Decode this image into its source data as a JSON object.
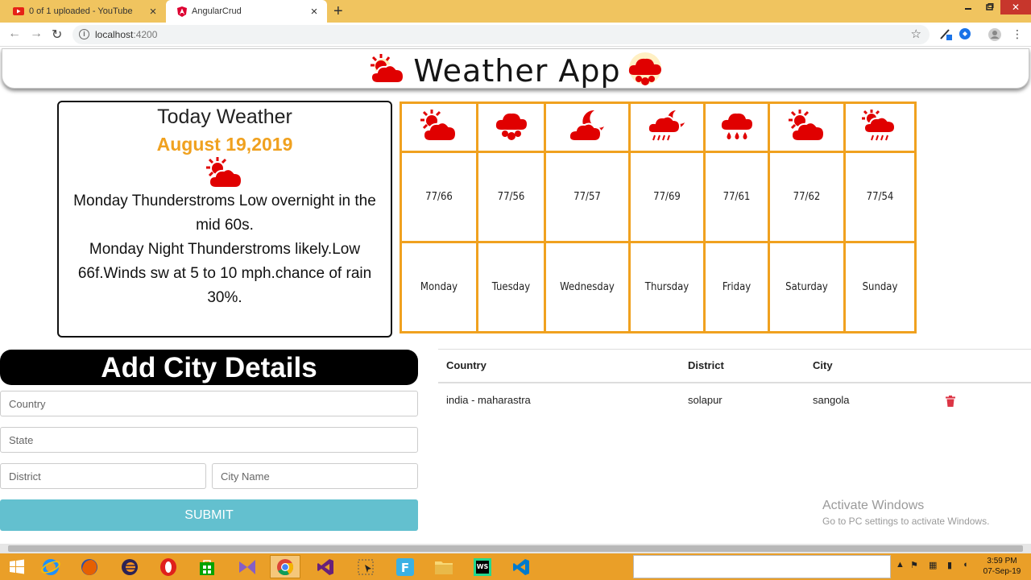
{
  "browser": {
    "tabs": [
      {
        "title": "0 of 1 uploaded - YouTube",
        "active": false,
        "icon": "youtube-icon"
      },
      {
        "title": "AngularCrud",
        "active": true,
        "icon": "angular-icon"
      }
    ],
    "url_host": "localhost",
    "url_port": ":4200"
  },
  "app": {
    "title": "Weather App",
    "title_icons": [
      "sun-cloud-icon",
      "hail-cloud-icon"
    ]
  },
  "today": {
    "heading": "Today Weather",
    "date": "August 19,2019",
    "icon": "sun-cloud-icon",
    "line1": "Monday Thunderstroms Low overnight in the mid 60s.",
    "line2": "Monday Night Thunderstroms likely.Low 66f.Winds sw at 5 to 10 mph.chance of rain 30%."
  },
  "forecast": [
    {
      "icon": "sun-cloud-icon",
      "temp": "77/66",
      "day": "Monday"
    },
    {
      "icon": "hail-cloud-icon",
      "temp": "77/56",
      "day": "Tuesday"
    },
    {
      "icon": "moon-cloud-icon",
      "temp": "77/57",
      "day": "Wednesday"
    },
    {
      "icon": "moon-rain-cloud-icon",
      "temp": "77/69",
      "day": "Thursday"
    },
    {
      "icon": "rain-cloud-icon",
      "temp": "77/61",
      "day": "Friday"
    },
    {
      "icon": "sun-cloud-icon",
      "temp": "77/62",
      "day": "Saturday"
    },
    {
      "icon": "sun-rain-cloud-icon",
      "temp": "77/54",
      "day": "Sunday"
    }
  ],
  "form": {
    "heading": "Add City Details",
    "country_placeholder": "Country",
    "state_placeholder": "State",
    "district_placeholder": "District",
    "city_placeholder": "City Name",
    "submit_label": "SUBMIT"
  },
  "table": {
    "headers": {
      "country": "Country",
      "district": "District",
      "city": "City"
    },
    "rows": [
      {
        "country": "india - maharastra",
        "district": "solapur",
        "city": "sangola"
      }
    ]
  },
  "watermark": {
    "line1": "Activate Windows",
    "line2": "Go to PC settings to activate Windows."
  },
  "taskbar": {
    "time": "3:59 PM",
    "date": "07-Sep-19"
  },
  "colors": {
    "tabbar": "#f0c45f",
    "accent_orange": "#f0a11f",
    "weather_icon_red": "#e00000",
    "submit_teal": "#63c0cf",
    "delete_red": "#dc3545",
    "taskbar": "#ea9f28"
  }
}
